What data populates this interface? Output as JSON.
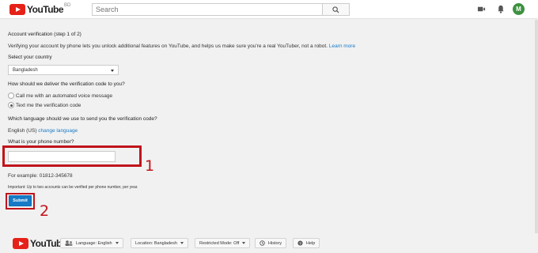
{
  "header": {
    "logo_text": "YouTube",
    "country_code": "BD",
    "search_placeholder": "Search",
    "avatar_letter": "M"
  },
  "page": {
    "step_title": "Account verification (step 1 of 2)",
    "intro": "Verifying your account by phone lets you unlock additional features on YouTube, and helps us make sure you're a real YouTuber, not a robot.",
    "learn_more": "Learn more",
    "country_label": "Select your country",
    "country_value": "Bangladesh",
    "delivery_question": "How should we deliver the verification code to you?",
    "delivery_options": [
      "Call me with an automated voice message",
      "Text me the verification code"
    ],
    "delivery_selected": 1,
    "language_question": "Which language should we use to send you the verification code?",
    "language_value": "English (US)",
    "change_language": "change language",
    "phone_question": "What is your phone number?",
    "phone_value": "",
    "example": "For example: 01812-345678",
    "important_label": "Important:",
    "important_text": "Up to two accounts can be verified per phone number, per year.",
    "submit_label": "Submit"
  },
  "annotations": {
    "marker_1": "1",
    "marker_2": "2",
    "color": "#c0141b"
  },
  "footer": {
    "logo_text": "YouTube",
    "language": "Language: English",
    "location": "Location: Bangladesh",
    "restricted": "Restricted Mode: Off",
    "history": "History",
    "help": "Help"
  },
  "colors": {
    "brand_red": "#e62117",
    "link_blue": "#167ac6",
    "avatar_green": "#3d9140"
  }
}
